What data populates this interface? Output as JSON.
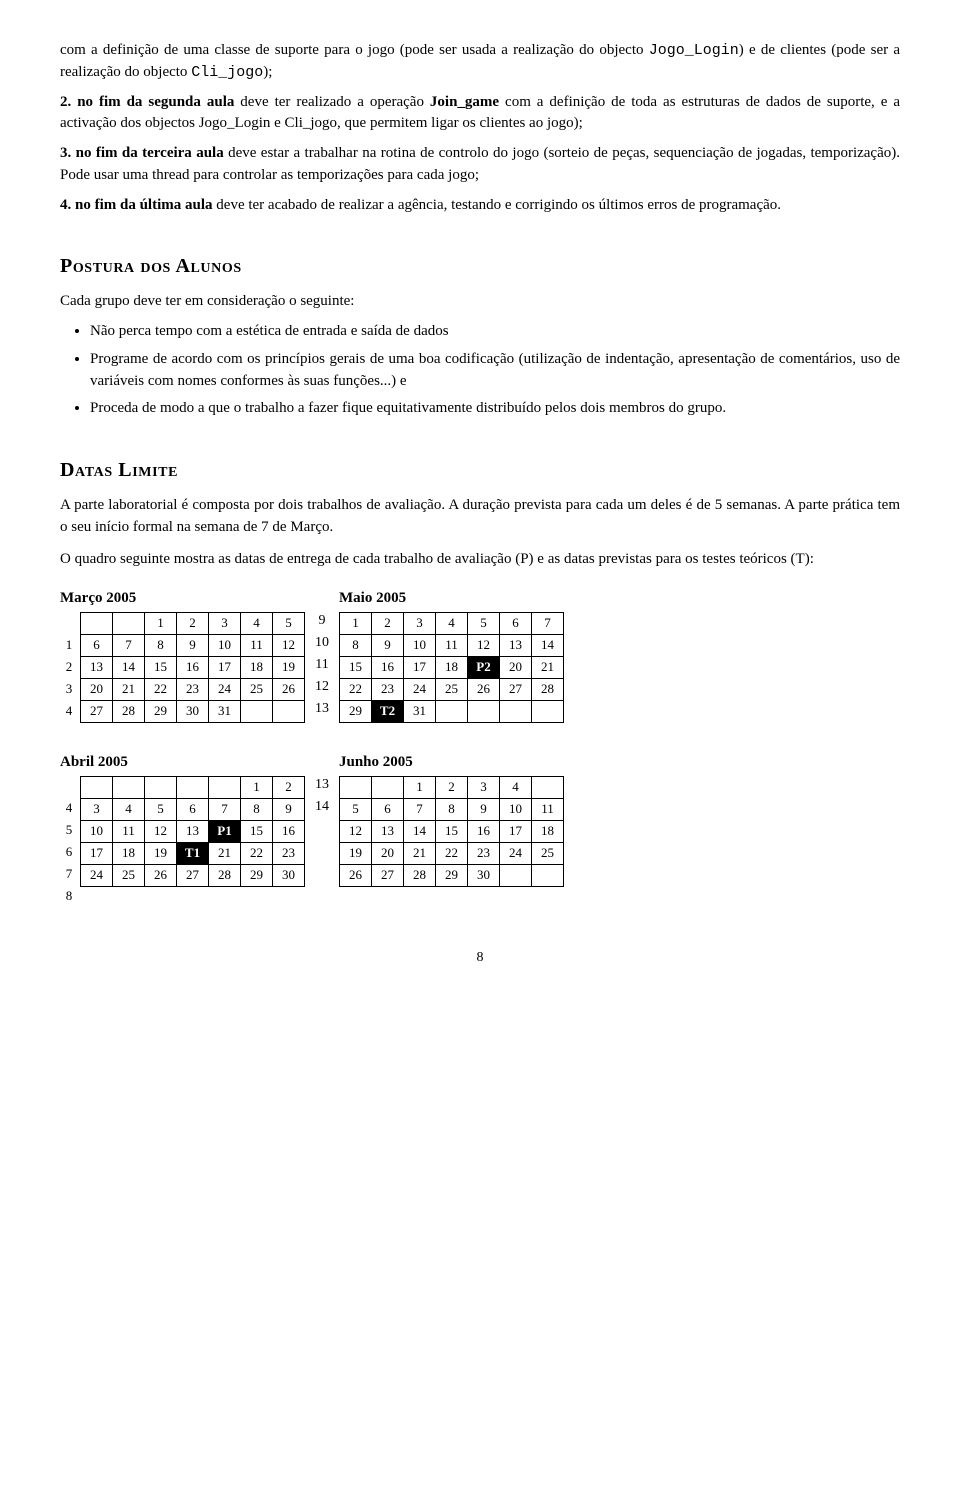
{
  "intro": {
    "p1": "com a definição de uma classe de suporte para o jogo (pode ser usada a realização do objecto Jogo_Login) e de clientes (pode ser a realização do objecto Cli_jogo);",
    "p2_label": "2.",
    "p2_bold": "no fim da segunda aula",
    "p2_text": " deve ter realizado a operação Join_game com a definição de toda as estruturas de dados de suporte, e a activação dos objectos Jogo_Login e Cli_jogo, que permitem ligar os clientes ao jogo);",
    "p3_label": "3.",
    "p3_bold": "no fim da terceira aula",
    "p3_text": " deve estar a trabalhar na rotina de controlo do jogo (sorteio de peças, sequenciação de jogadas, temporização). Pode usar uma thread para controlar as temporizações para cada jogo;",
    "p4_label": "4.",
    "p4_bold": "no fim da última aula",
    "p4_text": " deve ter acabado de realizar a agência, testando e corrigindo os últimos erros de programação."
  },
  "postura": {
    "title": "Postura dos Alunos",
    "intro": "Cada grupo deve ter em consideração o seguinte:",
    "bullets": [
      "Não perca tempo com a estética de entrada e saída de dados",
      "Programe de acordo com os princípios gerais de uma boa codificação (utilização de indentação, apresentação de comentários, uso de variáveis com nomes conformes às suas funções...) e",
      "Proceda de modo a que o trabalho a fazer fique equitativamente distribuído pelos dois membros do grupo."
    ]
  },
  "datas": {
    "title": "Datas Limite",
    "p1": "A parte laboratorial é composta por dois trabalhos de avaliação. A duração prevista para cada um deles é de 5 semanas. A parte prática tem o seu início formal na semana de 7 de Março.",
    "p2": "O quadro seguinte mostra as datas de entrega de cada trabalho de avaliação (P) e as datas previstas para os testes teóricos (T):"
  },
  "calendars": {
    "marco": {
      "title": "Março 2005",
      "rows": [
        [
          "",
          "",
          "1",
          "2",
          "3",
          "4",
          "5"
        ],
        [
          "6",
          "7",
          "8",
          "9",
          "10",
          "11",
          "12"
        ],
        [
          "13",
          "14",
          "15",
          "16",
          "17",
          "18",
          "19"
        ],
        [
          "20",
          "21",
          "22",
          "23",
          "24",
          "25",
          "26"
        ],
        [
          "27",
          "28",
          "29",
          "30",
          "31",
          "",
          ""
        ]
      ],
      "weeks": [
        "1",
        "2",
        "3",
        "4",
        ""
      ]
    },
    "abril": {
      "title": "Abril 2005",
      "rows": [
        [
          "",
          "",
          "",
          "",
          "",
          "1",
          "2"
        ],
        [
          "3",
          "4",
          "5",
          "6",
          "7",
          "8",
          "9"
        ],
        [
          "10",
          "11",
          "12",
          "13",
          "P1",
          "15",
          "16"
        ],
        [
          "17",
          "18",
          "19",
          "T1",
          "21",
          "22",
          "23"
        ],
        [
          "24",
          "25",
          "26",
          "27",
          "28",
          "29",
          "30"
        ]
      ],
      "weeks": [
        "4",
        "5",
        "6",
        "7",
        "8"
      ]
    },
    "maio": {
      "title": "Maio 2005",
      "rows": [
        [
          "1",
          "2",
          "3",
          "4",
          "5",
          "6",
          "7"
        ],
        [
          "8",
          "9",
          "10",
          "11",
          "12",
          "13",
          "14"
        ],
        [
          "15",
          "16",
          "17",
          "18",
          "P2",
          "20",
          "21"
        ],
        [
          "22",
          "23",
          "24",
          "25",
          "26",
          "27",
          "28"
        ],
        [
          "29",
          "T2",
          "31",
          "",
          "",
          "",
          ""
        ]
      ],
      "weeks": [
        "9",
        "10",
        "11",
        "12",
        "13"
      ]
    },
    "junho": {
      "title": "Junho 2005",
      "rows": [
        [
          "",
          "",
          "1",
          "2",
          "3",
          "4"
        ],
        [
          "5",
          "6",
          "7",
          "8",
          "9",
          "10",
          "11"
        ],
        [
          "12",
          "13",
          "14",
          "15",
          "16",
          "17",
          "18"
        ],
        [
          "19",
          "20",
          "21",
          "22",
          "23",
          "24",
          "25"
        ],
        [
          "26",
          "27",
          "28",
          "29",
          "30",
          "",
          ""
        ]
      ],
      "weeks": [
        "13",
        "14",
        "",
        "",
        ""
      ]
    }
  },
  "mid_weeks_top": [
    "9",
    "10",
    "11",
    "12",
    "13"
  ],
  "mid_weeks_bot": [
    "13",
    "14"
  ],
  "page_number": "8"
}
